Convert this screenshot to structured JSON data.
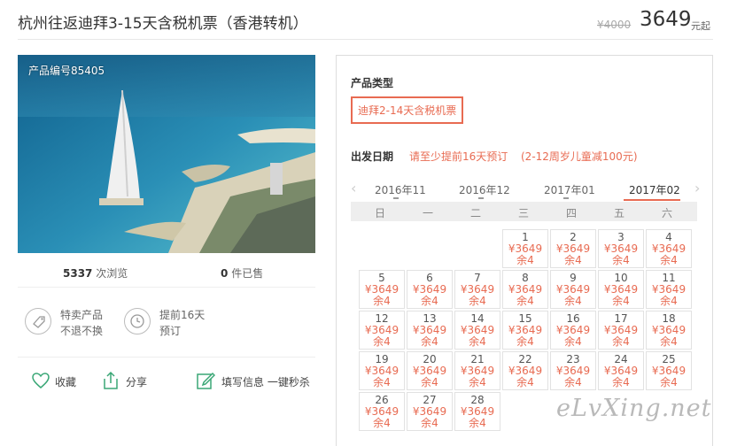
{
  "header": {
    "title": "杭州往返迪拜3-15天含税机票（香港转机）",
    "price_original": "¥4000",
    "price_current": "3649",
    "price_unit": "元起"
  },
  "photo": {
    "product_code": "产品编号85405"
  },
  "stats": {
    "views_count": "5337",
    "views_label": "次浏览",
    "sold_count": "0",
    "sold_label": "件已售"
  },
  "features": [
    {
      "icon": "tag-icon",
      "line1": "特卖产品",
      "line2": "不退不换"
    },
    {
      "icon": "clock-icon",
      "line1": "提前16天",
      "line2": "预订"
    }
  ],
  "actions": {
    "favorite": "收藏",
    "share": "分享",
    "fill_info": "填写信息 一键秒杀"
  },
  "booking": {
    "type_label": "产品类型",
    "type_option": "迪拜2-14天含税机票",
    "date_label": "出发日期",
    "date_note1": "请至少提前16天预订",
    "date_note2": "(2-12周岁儿童减100元)",
    "months": [
      "2016年11",
      "2016年12",
      "2017年01",
      "2017年02"
    ],
    "weekdays": [
      "日",
      "一",
      "二",
      "三",
      "四",
      "五",
      "六"
    ]
  },
  "calendar": {
    "price": "¥3649",
    "remain": "余4",
    "days": [
      {
        "d": "1"
      },
      {
        "d": "2"
      },
      {
        "d": "3"
      },
      {
        "d": "4"
      },
      {
        "d": "5"
      },
      {
        "d": "6"
      },
      {
        "d": "7"
      },
      {
        "d": "8"
      },
      {
        "d": "9"
      },
      {
        "d": "10"
      },
      {
        "d": "11"
      },
      {
        "d": "12"
      },
      {
        "d": "13"
      },
      {
        "d": "14"
      },
      {
        "d": "15"
      },
      {
        "d": "16"
      },
      {
        "d": "17"
      },
      {
        "d": "18"
      },
      {
        "d": "19"
      },
      {
        "d": "20"
      },
      {
        "d": "21"
      },
      {
        "d": "22"
      },
      {
        "d": "23"
      },
      {
        "d": "24"
      },
      {
        "d": "25"
      },
      {
        "d": "26"
      },
      {
        "d": "27"
      },
      {
        "d": "28"
      }
    ]
  },
  "watermark": "eLvXing.net",
  "colors": {
    "accent": "#e86b52"
  }
}
